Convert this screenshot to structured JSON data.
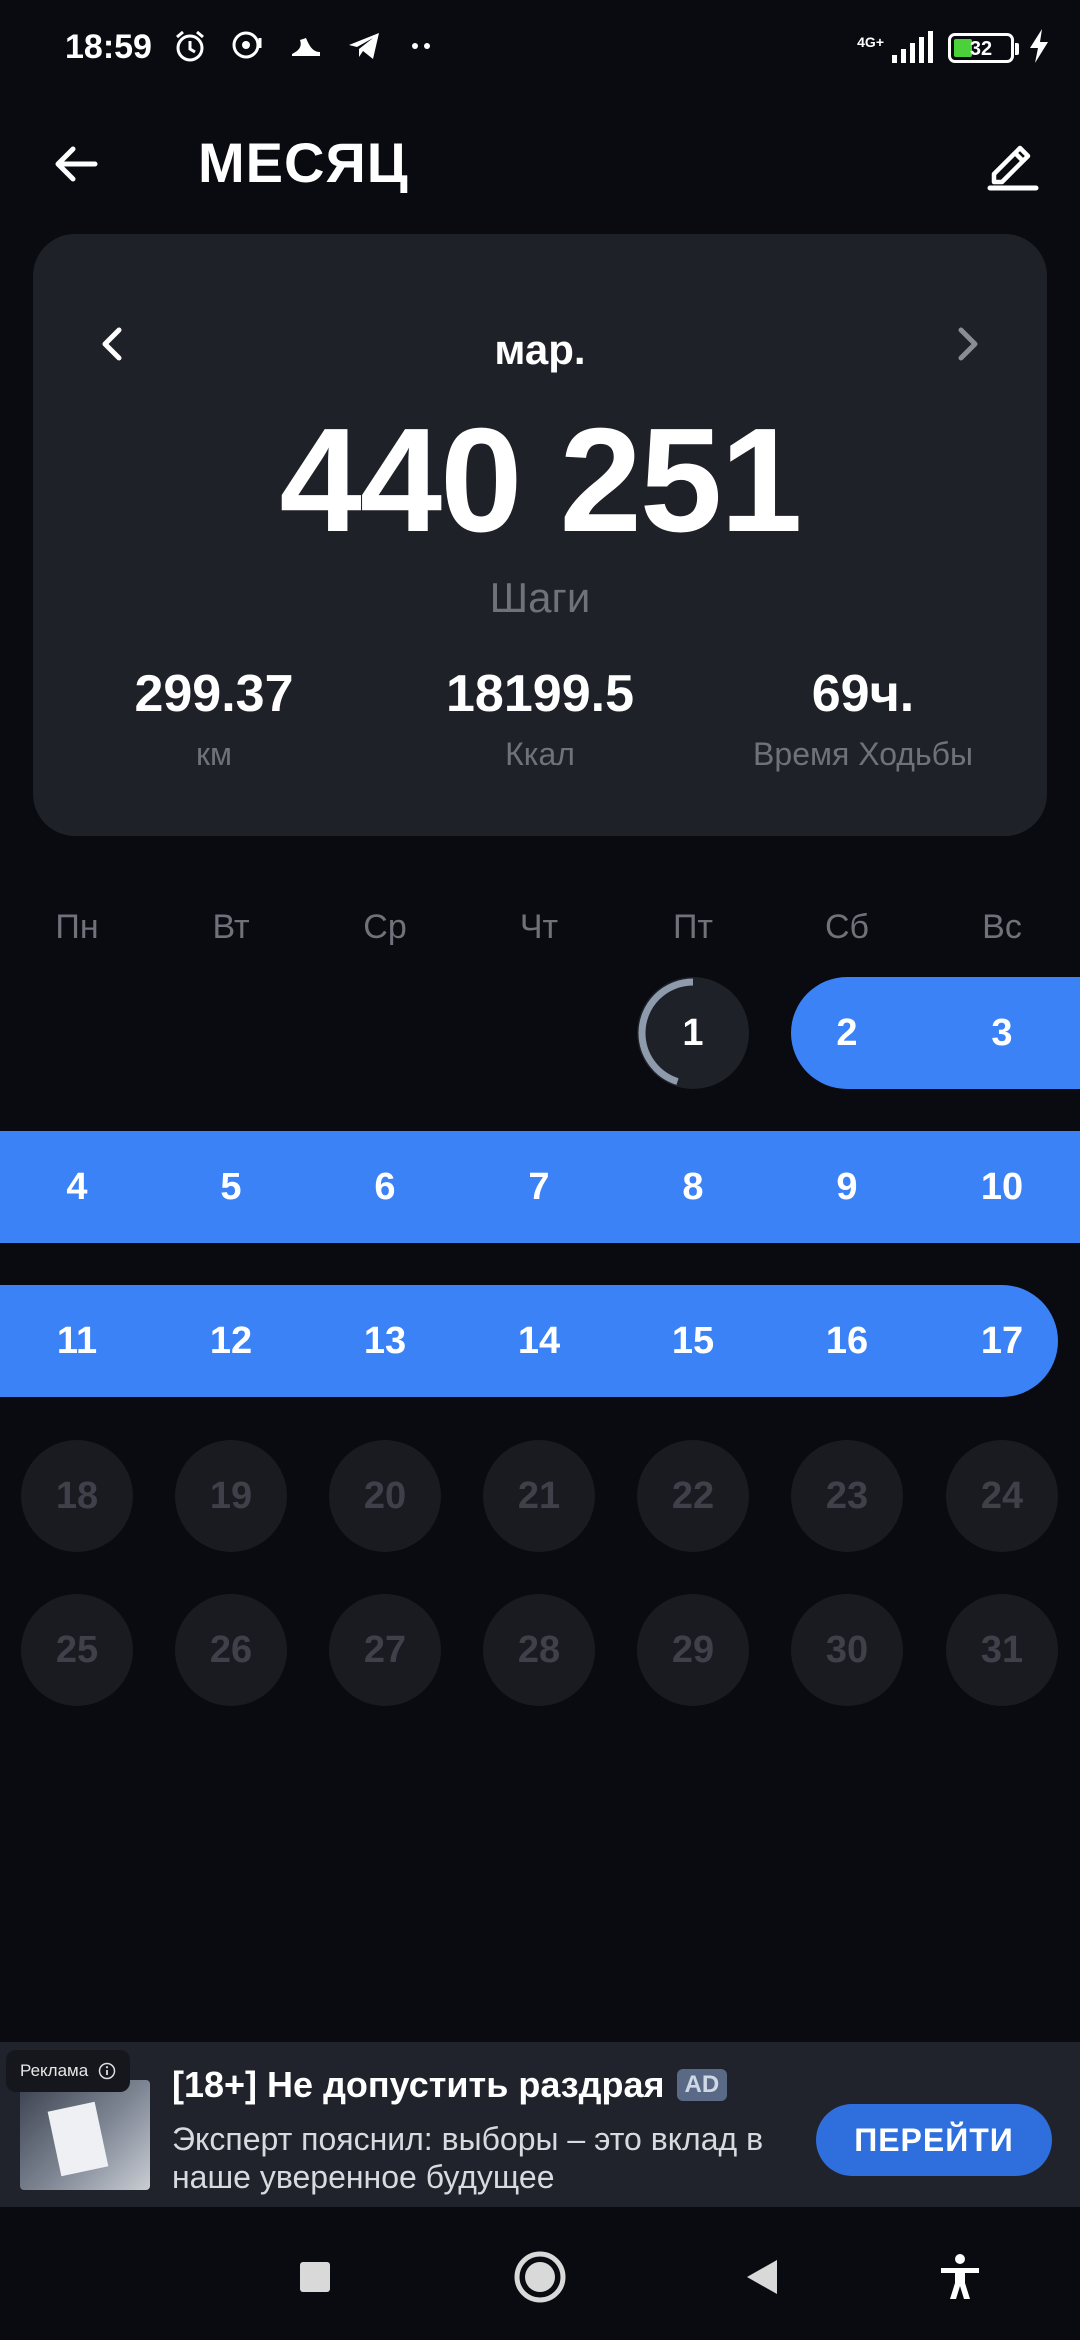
{
  "status_bar": {
    "time": "18:59",
    "network": "4G+",
    "battery": "32",
    "icons_left": [
      "alarm-icon",
      "chat-bubble-icon",
      "shoe-icon",
      "telegram-icon",
      "more-dots-icon"
    ],
    "icons_right": [
      "signal-icon",
      "battery-icon",
      "charging-bolt-icon"
    ]
  },
  "header": {
    "title": "МЕСЯЦ",
    "back_icon": "arrow-left-icon",
    "edit_icon": "pencil-icon"
  },
  "summary": {
    "month": "мар.",
    "steps": "440 251",
    "steps_label": "Шаги",
    "distance": "299.37",
    "distance_label": "км",
    "calories": "18199.5",
    "calories_label": "Ккал",
    "walk_time": "69ч.",
    "walk_time_label": "Время Ходьбы"
  },
  "calendar": {
    "weekdays": [
      "Пн",
      "Вт",
      "Ср",
      "Чт",
      "Пт",
      "Сб",
      "Вс"
    ],
    "first_weekday_index": 4,
    "days_in_month": 31,
    "goal_met_days": [
      2,
      3,
      4,
      5,
      6,
      7,
      8,
      9,
      10,
      11,
      12,
      13,
      14,
      15,
      16,
      17
    ],
    "today": 1,
    "today_progress": 0.45,
    "accent_color": "#3b82f6"
  },
  "ad": {
    "badge": "Реклама",
    "title": "[18+] Не допустить раздрая",
    "tag": "AD",
    "description": "Эксперт пояснил: выборы – это вклад в наше уверенное будущее",
    "cta": "ПЕРЕЙТИ",
    "cta_color": "#2f6fdd"
  },
  "nav": {
    "buttons": [
      "recents-square-icon",
      "home-circle-icon",
      "back-triangle-icon",
      "accessibility-icon"
    ]
  }
}
